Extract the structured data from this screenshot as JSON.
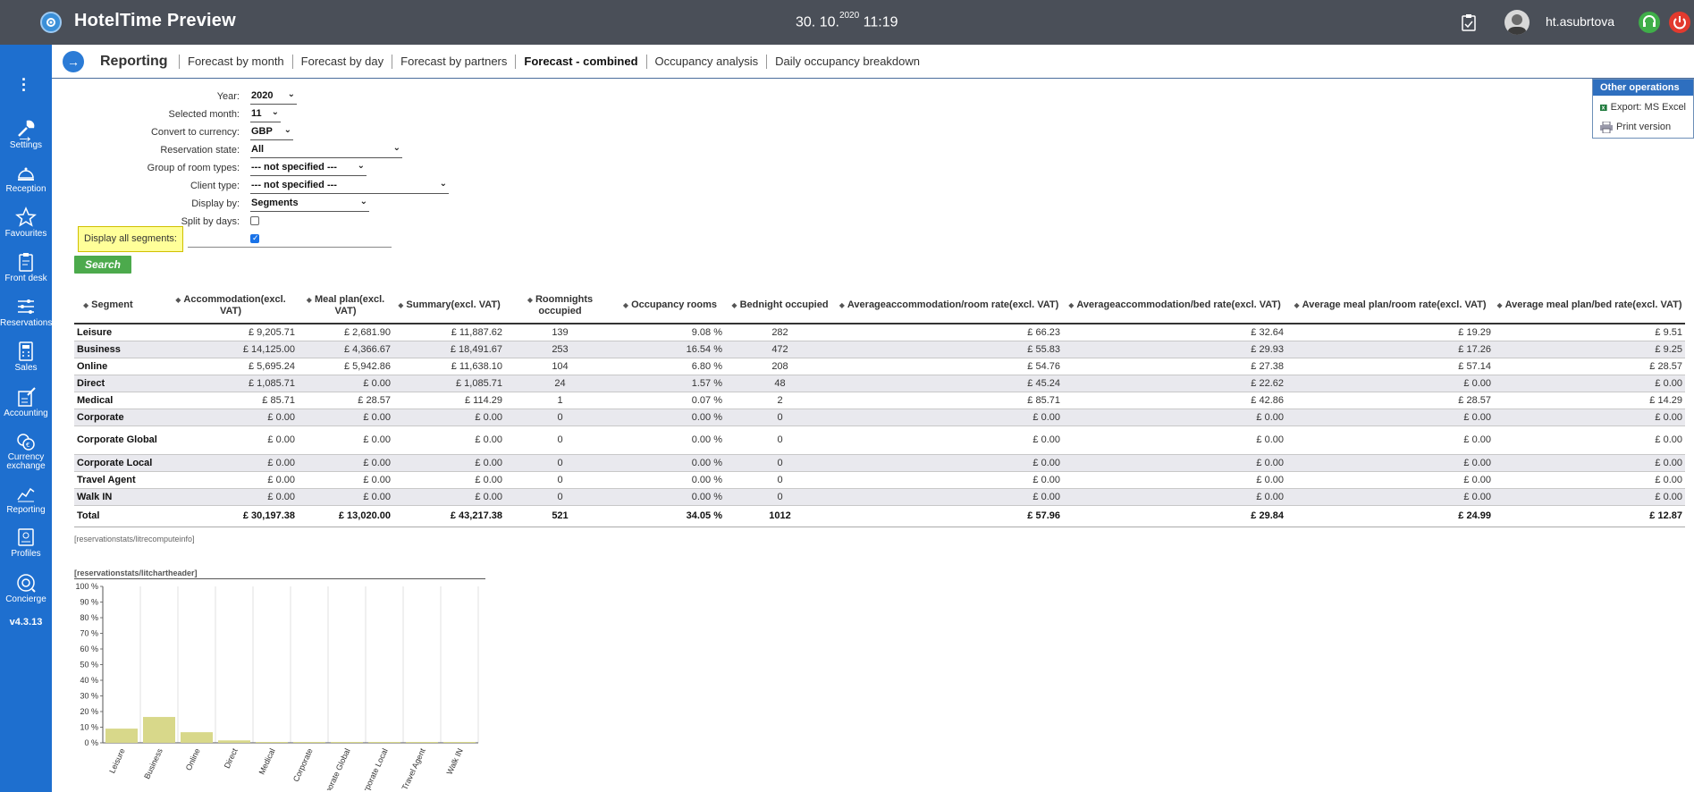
{
  "app": {
    "title": "HotelTime Preview",
    "date_main": "30. 10.",
    "date_year": "2020",
    "time": "11:19",
    "username": "ht.asubrtova"
  },
  "sidebar": {
    "items": [
      {
        "label": "Settings",
        "icon": "wrench-icon"
      },
      {
        "label": "Reception",
        "icon": "bell-icon"
      },
      {
        "label": "Favourites",
        "icon": "star-icon"
      },
      {
        "label": "Front desk",
        "icon": "clipboard-icon"
      },
      {
        "label": "Reservations",
        "icon": "sliders-icon"
      },
      {
        "label": "Sales",
        "icon": "calculator-icon"
      },
      {
        "label": "Accounting",
        "icon": "ledger-icon"
      },
      {
        "label": "Currency exchange",
        "icon": "coins-icon"
      },
      {
        "label": "Reporting",
        "icon": "chart-icon"
      },
      {
        "label": "Profiles",
        "icon": "profile-icon"
      },
      {
        "label": "Concierge",
        "icon": "concierge-icon"
      }
    ],
    "version": "v4.3.13"
  },
  "nav": {
    "section_title": "Reporting",
    "tabs": [
      {
        "label": "Forecast by month",
        "active": false
      },
      {
        "label": "Forecast by day",
        "active": false
      },
      {
        "label": "Forecast by partners",
        "active": false
      },
      {
        "label": "Forecast - combined",
        "active": true
      },
      {
        "label": "Occupancy analysis",
        "active": false
      },
      {
        "label": "Daily occupancy breakdown",
        "active": false
      }
    ]
  },
  "other_operations": {
    "title": "Other operations",
    "items": [
      "Export: MS Excel",
      "Print version"
    ]
  },
  "filters": {
    "year_label": "Year:",
    "year_value": "2020",
    "month_label": "Selected month:",
    "month_value": "11",
    "currency_label": "Convert to currency:",
    "currency_value": "GBP",
    "state_label": "Reservation state:",
    "state_value": "All",
    "room_group_label": "Group of room types:",
    "room_group_value": "--- not specified ---",
    "client_type_label": "Client type:",
    "client_type_value": "--- not specified ---",
    "display_by_label": "Display by:",
    "display_by_value": "Segments",
    "split_label": "Split by days:",
    "split_checked": false,
    "all_segments_label": "Display all segments:",
    "all_segments_checked": true,
    "search_label": "Search"
  },
  "table": {
    "headers": [
      "Segment",
      "Accommodation(excl. VAT)",
      "Meal plan(excl. VAT)",
      "Summary(excl. VAT)",
      "Roomnights occupied",
      "Occupancy rooms",
      "Bednight occupied",
      "Averageaccommodation/room rate(excl. VAT)",
      "Averageaccommodation/bed rate(excl. VAT)",
      "Average meal plan/room rate(excl. VAT)",
      "Average meal plan/bed rate(excl. VAT)"
    ],
    "rows": [
      [
        "Leisure",
        "£ 9,205.71",
        "£ 2,681.90",
        "£ 11,887.62",
        "139",
        "9.08 %",
        "282",
        "£ 66.23",
        "£ 32.64",
        "£ 19.29",
        "£ 9.51"
      ],
      [
        "Business",
        "£ 14,125.00",
        "£ 4,366.67",
        "£ 18,491.67",
        "253",
        "16.54 %",
        "472",
        "£ 55.83",
        "£ 29.93",
        "£ 17.26",
        "£ 9.25"
      ],
      [
        "Online",
        "£ 5,695.24",
        "£ 5,942.86",
        "£ 11,638.10",
        "104",
        "6.80 %",
        "208",
        "£ 54.76",
        "£ 27.38",
        "£ 57.14",
        "£ 28.57"
      ],
      [
        "Direct",
        "£ 1,085.71",
        "£ 0.00",
        "£ 1,085.71",
        "24",
        "1.57 %",
        "48",
        "£ 45.24",
        "£ 22.62",
        "£ 0.00",
        "£ 0.00"
      ],
      [
        "Medical",
        "£ 85.71",
        "£ 28.57",
        "£ 114.29",
        "1",
        "0.07 %",
        "2",
        "£ 85.71",
        "£ 42.86",
        "£ 28.57",
        "£ 14.29"
      ],
      [
        "Corporate",
        "£ 0.00",
        "£ 0.00",
        "£ 0.00",
        "0",
        "0.00 %",
        "0",
        "£ 0.00",
        "£ 0.00",
        "£ 0.00",
        "£ 0.00"
      ],
      [
        "Corporate Global",
        "£ 0.00",
        "£ 0.00",
        "£ 0.00",
        "0",
        "0.00 %",
        "0",
        "£ 0.00",
        "£ 0.00",
        "£ 0.00",
        "£ 0.00"
      ],
      [
        "Corporate Local",
        "£ 0.00",
        "£ 0.00",
        "£ 0.00",
        "0",
        "0.00 %",
        "0",
        "£ 0.00",
        "£ 0.00",
        "£ 0.00",
        "£ 0.00"
      ],
      [
        "Travel Agent",
        "£ 0.00",
        "£ 0.00",
        "£ 0.00",
        "0",
        "0.00 %",
        "0",
        "£ 0.00",
        "£ 0.00",
        "£ 0.00",
        "£ 0.00"
      ],
      [
        "Walk IN",
        "£ 0.00",
        "£ 0.00",
        "£ 0.00",
        "0",
        "0.00 %",
        "0",
        "£ 0.00",
        "£ 0.00",
        "£ 0.00",
        "£ 0.00"
      ]
    ],
    "total": [
      "Total",
      "£ 30,197.38",
      "£ 13,020.00",
      "£ 43,217.38",
      "521",
      "34.05 %",
      "1012",
      "£ 57.96",
      "£ 29.84",
      "£ 24.99",
      "£ 12.87"
    ]
  },
  "info_key": "[reservationstats/litrecomputeinfo]",
  "chart_header": "[reservationstats/litchartheader]",
  "chart_data": {
    "type": "bar",
    "categories": [
      "Leisure",
      "Business",
      "Online",
      "Direct",
      "Medical",
      "Corporate",
      "Corporate Global",
      "Corporate Local",
      "Travel Agent",
      "Walk IN"
    ],
    "values": [
      9.08,
      16.54,
      6.8,
      1.57,
      0.07,
      0.0,
      0.0,
      0.0,
      0.0,
      0.0
    ],
    "ylim": [
      0,
      100
    ],
    "yticks": [
      "0 %",
      "10 %",
      "20 %",
      "30 %",
      "40 %",
      "50 %",
      "60 %",
      "70 %",
      "80 %",
      "90 %",
      "100 %"
    ],
    "bar_color": "#d8d88a",
    "grid": true
  }
}
